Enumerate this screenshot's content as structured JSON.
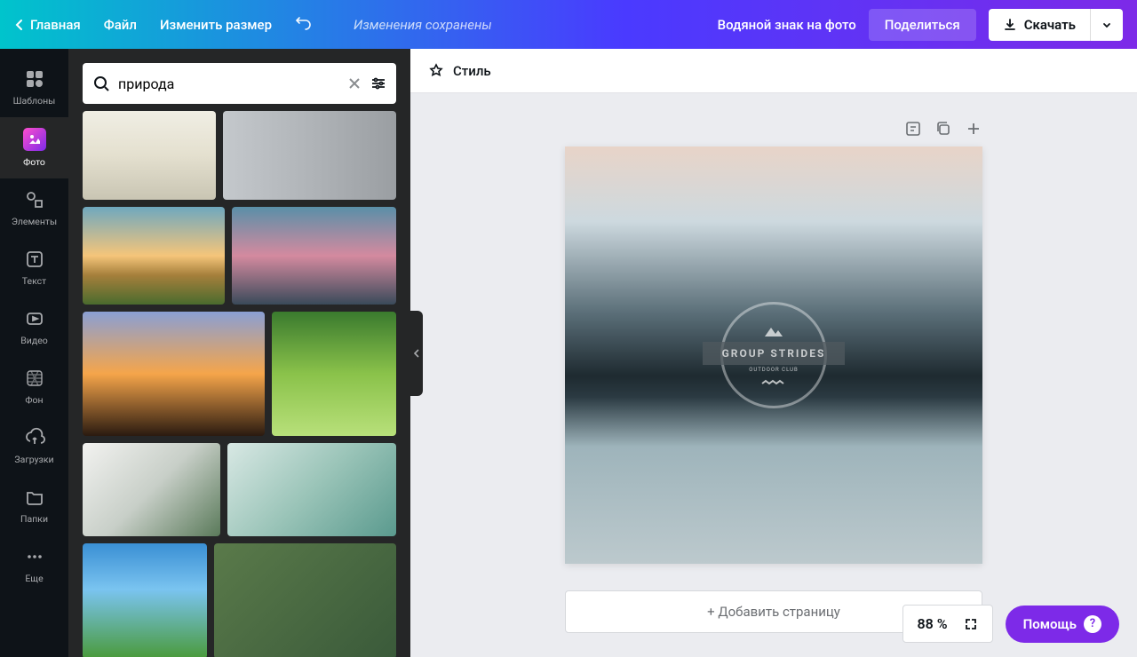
{
  "topbar": {
    "home": "Главная",
    "file": "Файл",
    "resize": "Изменить размер",
    "status": "Изменения сохранены",
    "watermark": "Водяной знак на фото",
    "share": "Поделиться",
    "download": "Скачать"
  },
  "sidebar": {
    "items": [
      {
        "label": "Шаблоны"
      },
      {
        "label": "Фото"
      },
      {
        "label": "Элементы"
      },
      {
        "label": "Текст"
      },
      {
        "label": "Видео"
      },
      {
        "label": "Фон"
      },
      {
        "label": "Загрузки"
      },
      {
        "label": "Папки"
      },
      {
        "label": "Еще"
      }
    ]
  },
  "search": {
    "value": "природа"
  },
  "canvas": {
    "style_label": "Стиль",
    "logo_text": "GROUP STRIDES",
    "logo_sub": "OUTDOOR CLUB",
    "add_page": "+ Добавить страницу"
  },
  "footer": {
    "zoom": "88 %",
    "help": "Помощь"
  }
}
